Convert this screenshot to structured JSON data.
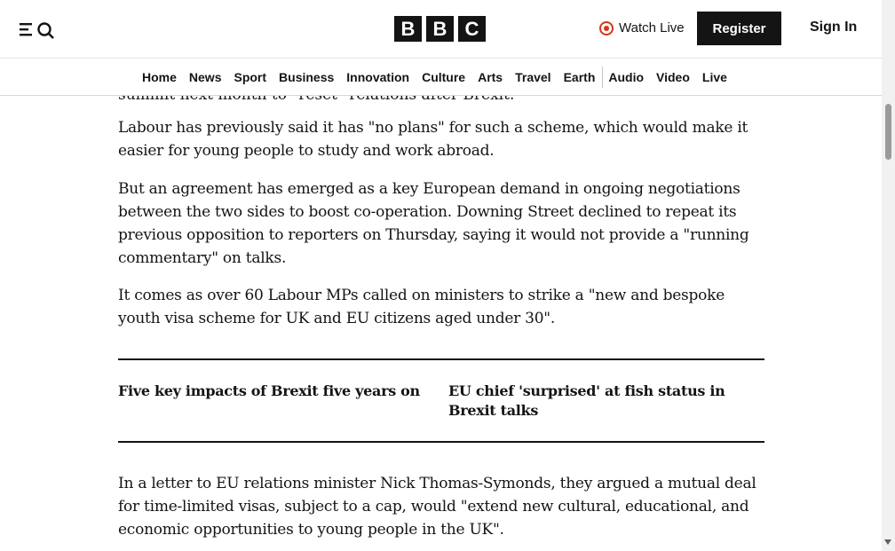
{
  "header": {
    "logo_letters": [
      "B",
      "B",
      "C"
    ],
    "watch_live": "Watch Live",
    "register": "Register",
    "sign_in": "Sign In",
    "icons": {
      "menu": "menu-icon",
      "search": "search-icon",
      "live": "live-dot-icon"
    },
    "accent_color": "#d4351c"
  },
  "nav": {
    "items": [
      "Home",
      "News",
      "Sport",
      "Business",
      "Innovation",
      "Culture",
      "Arts",
      "Travel",
      "Earth",
      "Audio",
      "Video",
      "Live"
    ]
  },
  "article": {
    "clipped_line": "summit next month to \"reset\" relations after Brexit.",
    "paragraphs": [
      "Labour has previously said it has \"no plans\" for such a scheme, which would make it easier for young people to study and work abroad.",
      "But an agreement has emerged as a key European demand in ongoing negotiations between the two sides to boost co-operation. Downing Street declined to repeat its previous opposition to reporters on Thursday, saying it would not provide a \"running commentary\" on talks.",
      "It comes as over 60 Labour MPs called on ministers to strike a \"new and bespoke youth visa scheme for UK and EU citizens aged under 30\".",
      "In a letter to EU relations minister Nick Thomas-Symonds, they argued a mutual deal for time-limited visas, subject to a cap, would \"extend new cultural, educational, and economic opportunities to young people in the UK\"."
    ],
    "related": [
      "Five key impacts of Brexit five years on",
      "EU chief 'surprised' at fish status in Brexit talks"
    ]
  }
}
